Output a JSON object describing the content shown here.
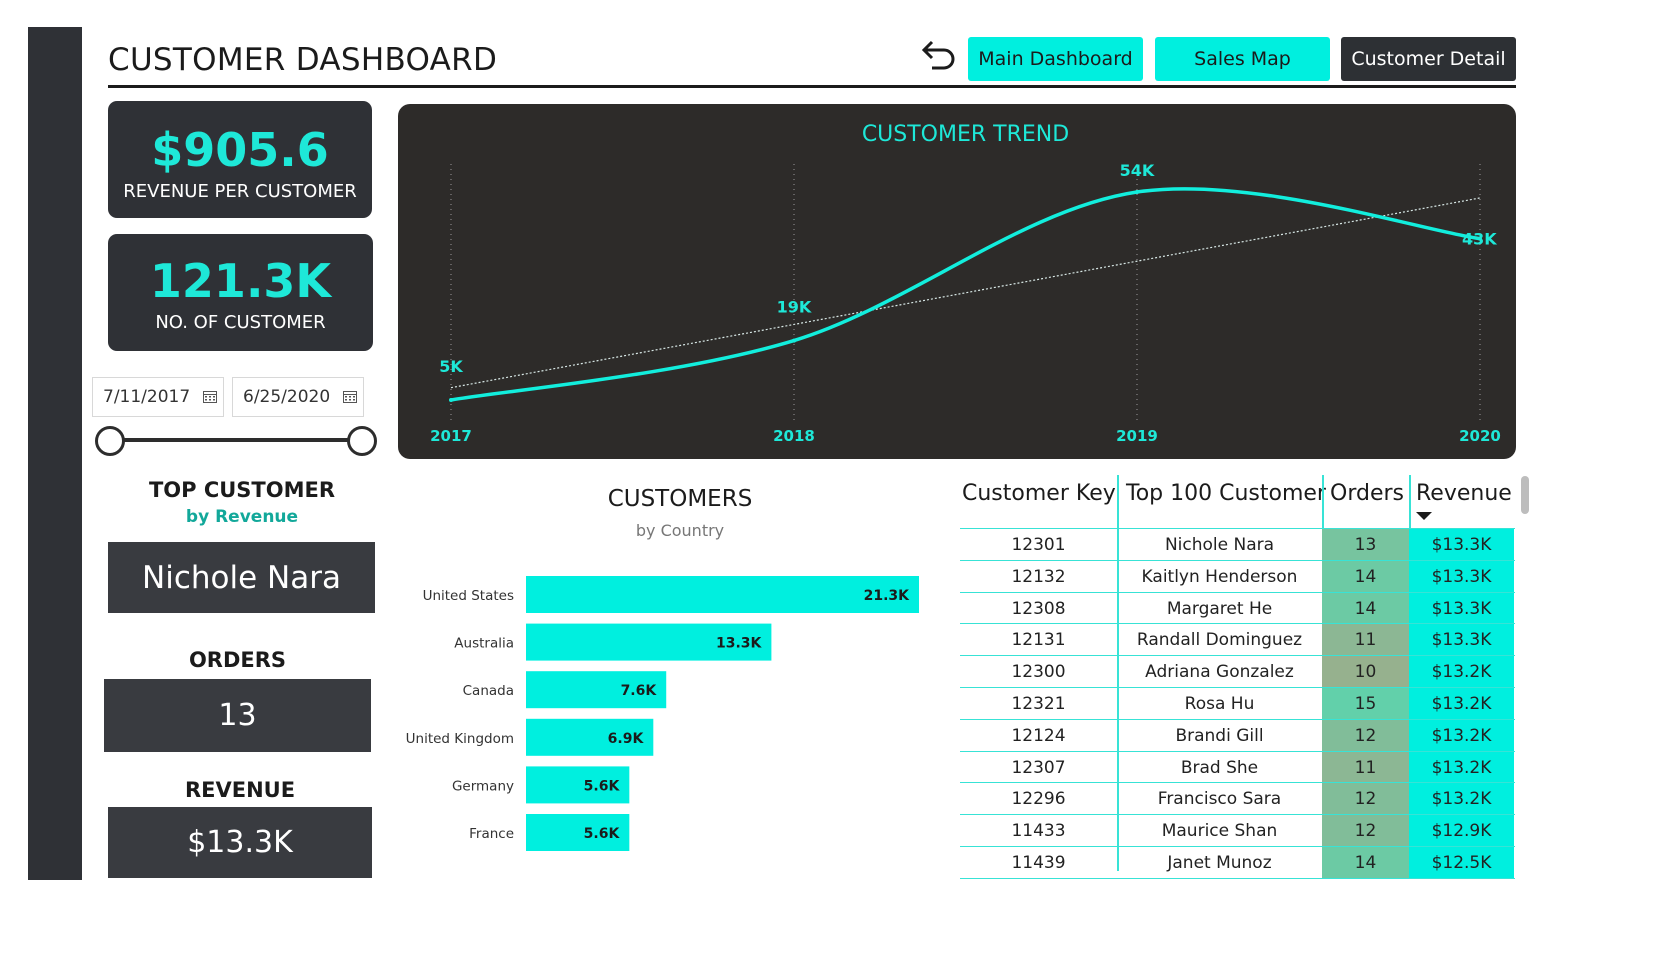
{
  "header": {
    "title": "CUSTOMER DASHBOARD",
    "nav": [
      "Main Dashboard",
      "Sales Map",
      "Customer Detail"
    ]
  },
  "kpis": {
    "revenue_per_customer": {
      "value": "$905.6",
      "label": "REVENUE PER CUSTOMER"
    },
    "customers": {
      "value": "121.3K",
      "label": "NO. OF CUSTOMER"
    }
  },
  "date_filter": {
    "from": "7/11/2017",
    "to": "6/25/2020"
  },
  "top_customer": {
    "title": "TOP CUSTOMER",
    "subtitle": "by Revenue",
    "name": "Nichole Nara",
    "orders_label": "ORDERS",
    "orders_value": "13",
    "revenue_label": "REVENUE",
    "revenue_value": "$13.3K"
  },
  "colors": {
    "accent": "#00efdf",
    "panel": "#2f3136",
    "trend_bg": "#2d2b29",
    "orders_fill": "#7dcfae"
  },
  "trend_title": "CUSTOMER TREND",
  "countries_title": "CUSTOMERS",
  "countries_subtitle": "by Country",
  "chart_data": [
    {
      "type": "line",
      "title": "CUSTOMER TREND",
      "x": [
        "2017",
        "2018",
        "2019",
        "2020"
      ],
      "series": [
        {
          "values": [
            5,
            19,
            54,
            43
          ],
          "labels": [
            "5K",
            "19K",
            "54K",
            "43K"
          ]
        }
      ],
      "trendline": true,
      "grid": "vertical dotted"
    },
    {
      "type": "bar",
      "orientation": "horizontal",
      "title": "CUSTOMERS",
      "subtitle": "by Country",
      "categories": [
        "United States",
        "Australia",
        "Canada",
        "United Kingdom",
        "Germany",
        "France"
      ],
      "values": [
        21.3,
        13.3,
        7.6,
        6.9,
        5.6,
        5.6
      ],
      "labels": [
        "21.3K",
        "13.3K",
        "7.6K",
        "6.9K",
        "5.6K",
        "5.6K"
      ]
    }
  ],
  "table": {
    "columns": [
      "Customer Key",
      "Top 100 Customer",
      "Orders",
      "Revenue"
    ],
    "rows": [
      {
        "key": "12301",
        "name": "Nichole Nara",
        "orders": 13,
        "revenue": "$13.3K"
      },
      {
        "key": "12132",
        "name": "Kaitlyn Henderson",
        "orders": 14,
        "revenue": "$13.3K"
      },
      {
        "key": "12308",
        "name": "Margaret He",
        "orders": 14,
        "revenue": "$13.3K"
      },
      {
        "key": "12131",
        "name": "Randall Dominguez",
        "orders": 11,
        "revenue": "$13.3K"
      },
      {
        "key": "12300",
        "name": "Adriana Gonzalez",
        "orders": 10,
        "revenue": "$13.2K"
      },
      {
        "key": "12321",
        "name": "Rosa Hu",
        "orders": 15,
        "revenue": "$13.2K"
      },
      {
        "key": "12124",
        "name": "Brandi Gill",
        "orders": 12,
        "revenue": "$13.2K"
      },
      {
        "key": "12307",
        "name": "Brad She",
        "orders": 11,
        "revenue": "$13.2K"
      },
      {
        "key": "12296",
        "name": "Francisco Sara",
        "orders": 12,
        "revenue": "$13.2K"
      },
      {
        "key": "11433",
        "name": "Maurice Shan",
        "orders": 12,
        "revenue": "$12.9K"
      },
      {
        "key": "11439",
        "name": "Janet Munoz",
        "orders": 14,
        "revenue": "$12.5K"
      }
    ]
  }
}
